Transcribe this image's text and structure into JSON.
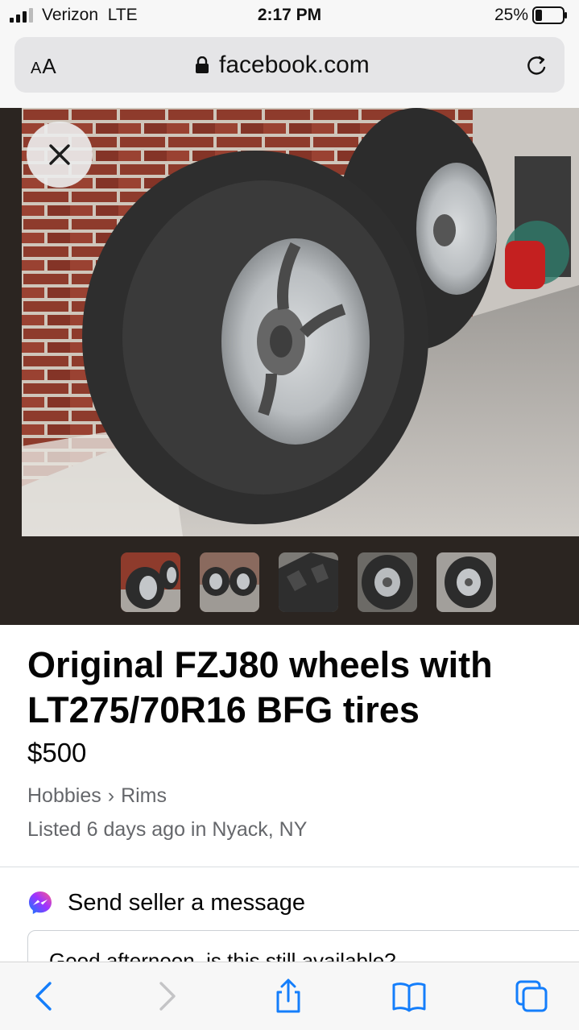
{
  "status_bar": {
    "carrier": "Verizon",
    "network": "LTE",
    "time": "2:17 PM",
    "battery_percent": "25%",
    "battery_level": 0.25
  },
  "browser": {
    "text_size_label": "AA",
    "url": "facebook.com",
    "icons": [
      "lock-icon",
      "reload-icon"
    ]
  },
  "viewer": {
    "close_icon": "close-icon",
    "thumbnail_count": 5
  },
  "listing": {
    "title": "Original FZJ80 wheels with LT275/70R16 BFG tires",
    "price": "$500",
    "category": "Hobbies",
    "subcategory": "Rims",
    "breadcrumb_separator": "›",
    "listed_text": "Listed 6 days ago in Nyack, NY"
  },
  "message": {
    "heading": "Send seller a message",
    "input_value": "Good afternoon, is this still available?"
  },
  "toolbar": {
    "items": [
      "back-icon",
      "forward-icon",
      "share-icon",
      "bookmarks-icon",
      "tabs-icon"
    ]
  },
  "colors": {
    "accent": "#1877f2",
    "secondary_text": "#65676b",
    "browser_blue": "#147efb"
  }
}
